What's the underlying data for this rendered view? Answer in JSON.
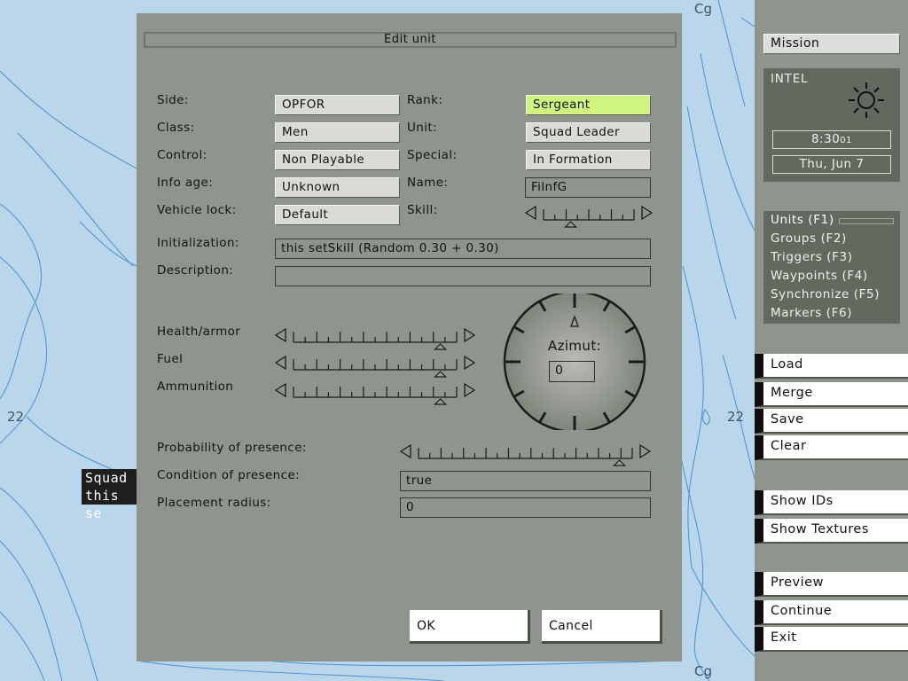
{
  "map": {
    "labels": [
      "Cg",
      "Cg",
      "22",
      "22"
    ],
    "unit_tag": {
      "line1": "Squad",
      "line2": "this se"
    }
  },
  "dialog": {
    "title": "Edit unit",
    "left_fields": [
      {
        "label": "Side:",
        "value": "OPFOR",
        "kind": "combo"
      },
      {
        "label": "Class:",
        "value": "Men",
        "kind": "combo"
      },
      {
        "label": "Control:",
        "value": "Non Playable",
        "kind": "combo"
      },
      {
        "label": "Info age:",
        "value": "Unknown",
        "kind": "combo"
      },
      {
        "label": "Vehicle lock:",
        "value": "Default",
        "kind": "combo"
      }
    ],
    "right_fields": [
      {
        "label": "Rank:",
        "value": "Sergeant",
        "kind": "combo",
        "highlight": "#cff47f"
      },
      {
        "label": "Unit:",
        "value": "Squad Leader",
        "kind": "combo"
      },
      {
        "label": "Special:",
        "value": "In Formation",
        "kind": "combo"
      },
      {
        "label": "Name:",
        "value": "FilnfG",
        "kind": "edit"
      },
      {
        "label": "Skill:",
        "value": "",
        "kind": "slider"
      }
    ],
    "initialization": {
      "label": "Initialization:",
      "value": "this setSkill (Random 0.30 + 0.30)"
    },
    "description": {
      "label": "Description:",
      "value": ""
    },
    "sliders": [
      {
        "label": "Health/armor",
        "level": 0.9
      },
      {
        "label": "Fuel",
        "level": 0.9
      },
      {
        "label": "Ammunition",
        "level": 0.9
      }
    ],
    "skill_level": 0.3,
    "azimut": {
      "label": "Azimut:",
      "value": "0"
    },
    "probability": {
      "label": "Probability of presence:",
      "level": 0.94
    },
    "condition": {
      "label": "Condition of presence:",
      "value": "true"
    },
    "placement": {
      "label": "Placement radius:",
      "value": "0"
    },
    "ok_label": "OK",
    "cancel_label": "Cancel"
  },
  "panel": {
    "mission_label": "Mission",
    "intel": {
      "title": "INTEL",
      "time": "8:30",
      "time_sec": "01",
      "date": "Thu, Jun 7"
    },
    "modes": [
      "Units (F1)",
      "Groups (F2)",
      "Triggers (F3)",
      "Waypoints (F4)",
      "Synchronize (F5)",
      "Markers (F6)"
    ],
    "buttons": [
      "Load",
      "Merge",
      "Save",
      "Clear",
      "Show IDs",
      "Show Textures",
      "Preview",
      "Continue",
      "Exit"
    ]
  },
  "colors": {
    "dialog_bg": "#8f958c",
    "map_bg": "#b9d6ea",
    "contour": "#4f8fd0",
    "highlight": "#cff47f"
  }
}
